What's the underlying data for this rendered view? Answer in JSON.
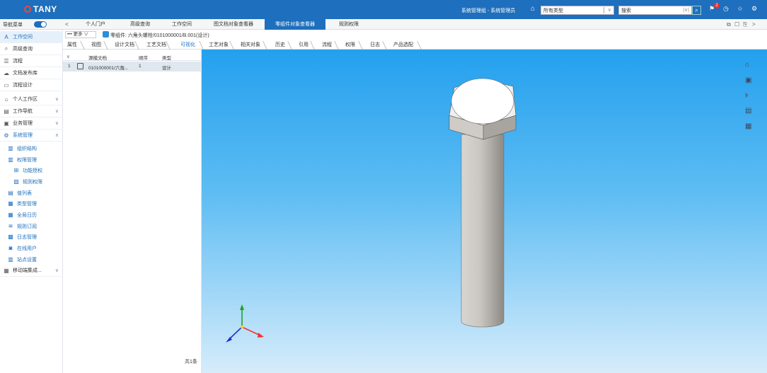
{
  "header": {
    "logo": "TANY",
    "user": "系统管理组 - 系统管理员",
    "type_select": "所有类型",
    "search_placeholder": "搜索",
    "notification_count": "2"
  },
  "nav": {
    "label": "导航菜单",
    "tabs": [
      {
        "label": "个人门户"
      },
      {
        "label": "高级查询"
      },
      {
        "label": "工作空间"
      },
      {
        "label": "图文档对象查看器"
      },
      {
        "label": "零组件对象查看器",
        "active": true
      },
      {
        "label": "规则权限"
      }
    ]
  },
  "sidebar": {
    "items": [
      {
        "label": "工作空间",
        "icon": "A"
      },
      {
        "label": "高级查询",
        "icon": "⌕"
      },
      {
        "label": "流程",
        "icon": "☰"
      },
      {
        "label": "文档发布库",
        "icon": "☁"
      },
      {
        "label": "流程设计",
        "icon": "▭"
      },
      {
        "label": "个人工作区",
        "icon": "⌂"
      },
      {
        "label": "工作导航",
        "icon": "▤"
      },
      {
        "label": "业务管理",
        "icon": "▣"
      },
      {
        "label": "系统管理",
        "icon": "⚙"
      }
    ],
    "sub_items": [
      {
        "label": "组织结构",
        "icon": "▥"
      },
      {
        "label": "权限管理",
        "icon": "▥"
      },
      {
        "label": "功能授权",
        "icon": "⊞"
      },
      {
        "label": "规则权限",
        "icon": "▨"
      },
      {
        "label": "值列表",
        "icon": "▤"
      },
      {
        "label": "类型管理",
        "icon": "▦"
      },
      {
        "label": "全局日历",
        "icon": "▦"
      },
      {
        "label": "规则订阅",
        "icon": "≋"
      },
      {
        "label": "日志管理",
        "icon": "▩"
      },
      {
        "label": "在线用户",
        "icon": "◙"
      },
      {
        "label": "站点设置",
        "icon": "▥"
      }
    ],
    "last_item": {
      "label": "移动端集成...",
      "icon": "▦"
    }
  },
  "object": {
    "more_label": "更多",
    "title": "零组件: 六角头螺栓/0101000001/B.001(设计)"
  },
  "subtabs": [
    "属性",
    "视图",
    "设计文档",
    "工艺文档",
    "可视化",
    "工艺对象",
    "相关对象",
    "历史",
    "引用",
    "流程",
    "权限",
    "日志",
    "产品选配"
  ],
  "table": {
    "columns": [
      "",
      "源模文档",
      "顺序",
      "类型"
    ],
    "rows": [
      {
        "index": "1",
        "doc": "0101000001/六角...",
        "order": "1",
        "type": "设计"
      }
    ],
    "count_label": "共1条"
  },
  "colors": {
    "primary": "#1e6fbd",
    "viewer_top": "#23a0ee",
    "viewer_bottom": "#d6ecfb"
  }
}
